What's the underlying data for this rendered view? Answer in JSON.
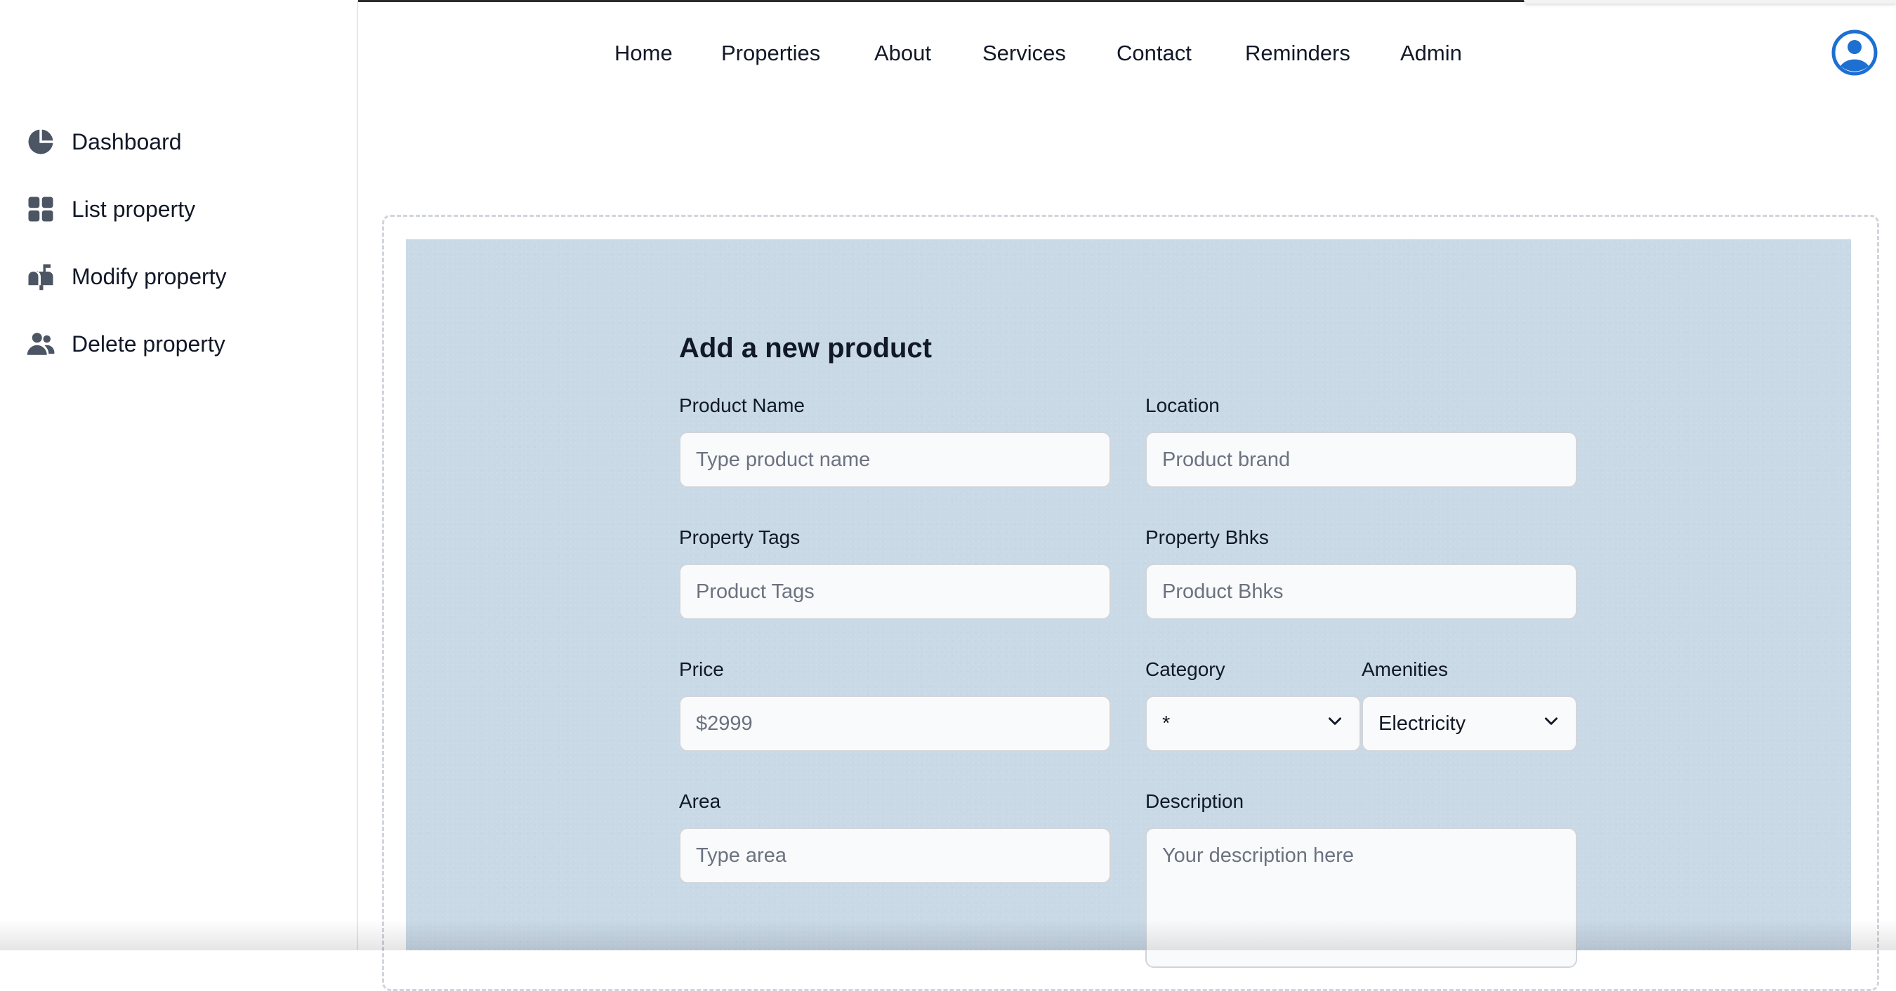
{
  "sidebar": {
    "items": [
      {
        "label": "Dashboard",
        "icon": "pie-chart-icon"
      },
      {
        "label": "List property",
        "icon": "grid-icon"
      },
      {
        "label": "Modify property",
        "icon": "mailbox-icon"
      },
      {
        "label": "Delete property",
        "icon": "users-icon"
      }
    ]
  },
  "nav": {
    "links": [
      "Home",
      "Properties",
      "About",
      "Services",
      "Contact",
      "Reminders",
      "Admin"
    ],
    "avatar_icon": "user-circle-icon",
    "avatar_color": "#1d6fd1"
  },
  "form": {
    "title": "Add a new product",
    "product_name": {
      "label": "Product Name",
      "placeholder": "Type product name"
    },
    "location": {
      "label": "Location",
      "placeholder": "Product brand"
    },
    "tags": {
      "label": "Property Tags",
      "placeholder": "Product Tags"
    },
    "bhks": {
      "label": "Property Bhks",
      "placeholder": "Product Bhks"
    },
    "price": {
      "label": "Price",
      "placeholder": "$2999"
    },
    "category": {
      "label": "Category",
      "value": "*"
    },
    "amenities": {
      "label": "Amenities",
      "value": "Electricity"
    },
    "area": {
      "label": "Area",
      "placeholder": "Type area"
    },
    "description": {
      "label": "Description",
      "placeholder": "Your description here"
    }
  }
}
